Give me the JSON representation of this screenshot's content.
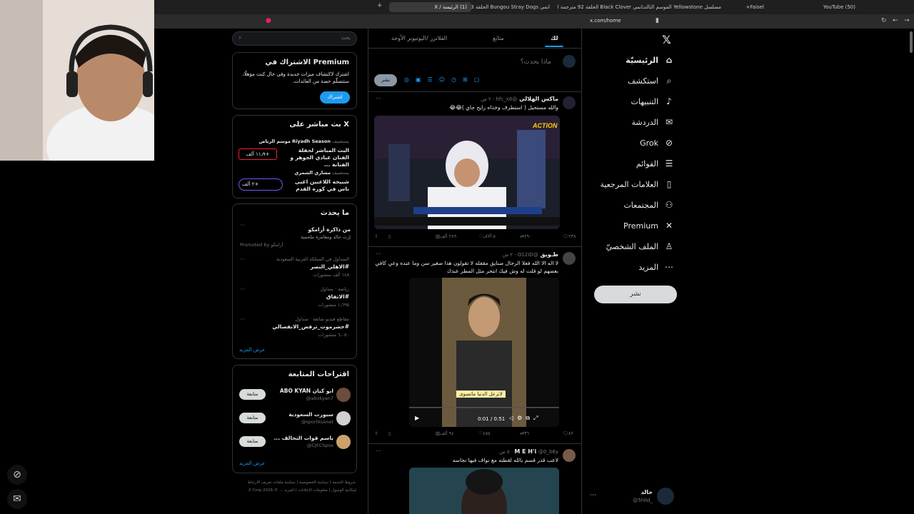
{
  "browser": {
    "tabs": [
      {
        "label": "(50) YouTube"
      },
      {
        "label": "Faisel+"
      },
      {
        "label": "مسلسل Yellowstone الموسم الثالث"
      },
      {
        "label": "انمي Black Clover الحلقة 92 مترجمة ا"
      },
      {
        "label": "انمي Bungou Stray Dogs الحلقة 3 مت"
      },
      {
        "label": "(1) الرئيسة / X"
      }
    ],
    "url": "x.com/home"
  },
  "nav": {
    "items": [
      {
        "label": "الرئيسيّة",
        "icon": "home-icon"
      },
      {
        "label": "استكشف",
        "icon": "search-icon"
      },
      {
        "label": "التنبيهات",
        "icon": "bell-icon"
      },
      {
        "label": "الدردشة",
        "icon": "mail-icon"
      },
      {
        "label": "Grok",
        "icon": "grok-icon"
      },
      {
        "label": "القوائم",
        "icon": "list-icon"
      },
      {
        "label": "العلامات المرجعية",
        "icon": "bookmark-icon"
      },
      {
        "label": "المجتمعات",
        "icon": "people-icon"
      },
      {
        "label": "Premium",
        "icon": "x-logo-icon"
      },
      {
        "label": "الملف الشخصيّ",
        "icon": "person-icon"
      },
      {
        "label": "المزيد",
        "icon": "more-icon"
      }
    ],
    "post_label": "نشر",
    "user_name": "خالد",
    "user_handle": "@5hlid_"
  },
  "feed": {
    "tabs": [
      "لك",
      "متابَع",
      "الفلاتزر /اليوتيوبر الأوحد"
    ],
    "compose_placeholder": "ماذا يحدث؟",
    "compose_post": "نشر",
    "posts": [
      {
        "author": "ماكس الهلالي",
        "handle": "@hfc_x6 · ٢ س",
        "text": "والله مستحيل ( استطرف وخذاه رايح جاي )😂😂",
        "replies": "٢٣٨",
        "reposts": "٢٩٠",
        "likes": "٥ آلاف",
        "views": "٢٨٩ ألف"
      },
      {
        "author": "ﻃـﻮﻳﻖ",
        "handle": "@O12ID · ٢ س",
        "text": "لا اله الا الله فعلا الرجال صنايق مقفله لا تقولون هذا صغير سن وما عنده وعي كافي بعضهم لو قلت له وش فيك انتحر مثل المطر عندك",
        "video_caption": "لاتزعل الدنيا ماتسوى",
        "video_time": "0:01 / 0:51",
        "replies": "٨٢",
        "reposts": "٣٦",
        "likes": "٤٥٥",
        "views": "٩٤ ألف"
      },
      {
        "author": "M E H'i",
        "handle": "@0_b6y · ٥ س",
        "text": "لاعب قدر قسم بالله لقطته مع نواف فيها نجاسه"
      }
    ]
  },
  "sidebar": {
    "search_placeholder": "بحث",
    "premium": {
      "title": "Premium الاشتراك في",
      "body": "اشترك لاكتشاف ميزات جديدة وفي حال كنت مؤهلًا، ستتسلّم حصة من العائدات.",
      "button": "اشتراك"
    },
    "live": {
      "title": "X بث مباشر على",
      "items": [
        {
          "host": "Riyadh Season موسم الرياض",
          "title": "البث المباشر لحفلة الفنان عبادي الجوهر و الفنانة ...",
          "count": "١١٫٩ ألف+",
          "prefix": "يستضيف"
        },
        {
          "host": "مشاري الشمري",
          "title": "شبيحه اللاعبين اغبى ناس في كوره القدم",
          "count": "٢ ألف+",
          "prefix": "يستضيف"
        }
      ]
    },
    "trends": {
      "title": "ما يحدث",
      "promo_title": "من ذاكرة أرامكو",
      "promo_body": "إرث خالد ومغامرة ملحمية",
      "promo_by": "Promoted by أرامكو",
      "items": [
        {
          "context": "المتداول في المملكة العربية السعودية",
          "tag": "#الاهلي_النصر",
          "count": "١٤٨ ألف منشورات"
        },
        {
          "context": "رياضة · متداول",
          "tag": "#الاتفاق",
          "count": "١٫٦٩٥ منشورات"
        },
        {
          "context": "مقاطع فيديو شائعة · متداول",
          "tag": "#حضرموت_ترفض_الانفصالي",
          "count": "٦٫٠٥٠ منشورات"
        }
      ],
      "show_more": "عرض المزيد"
    },
    "follow": {
      "title": "اقتراحات المتابعة",
      "items": [
        {
          "name": "ابو كيان ABO KYAN",
          "handle": "@abokyan7",
          "button": "متابعة"
        },
        {
          "name": "سبورت السعودية",
          "handle": "@sportksanet",
          "button": "متابعة"
        },
        {
          "name": "باسم قوات التحالف ...",
          "handle": "@CJFCSpox",
          "button": "متابعة"
        }
      ],
      "show_more": "عرض المزيد"
    },
    "footer": {
      "links": [
        "شروط الخدمة",
        "سياسة الخصوصية",
        "سياسة ملفات تعريف الارتباط",
        "إمكانية الوصول",
        "معلومات الإعلانات",
        "المزيد ..."
      ],
      "copyright": "© 2026 X Corp."
    }
  }
}
